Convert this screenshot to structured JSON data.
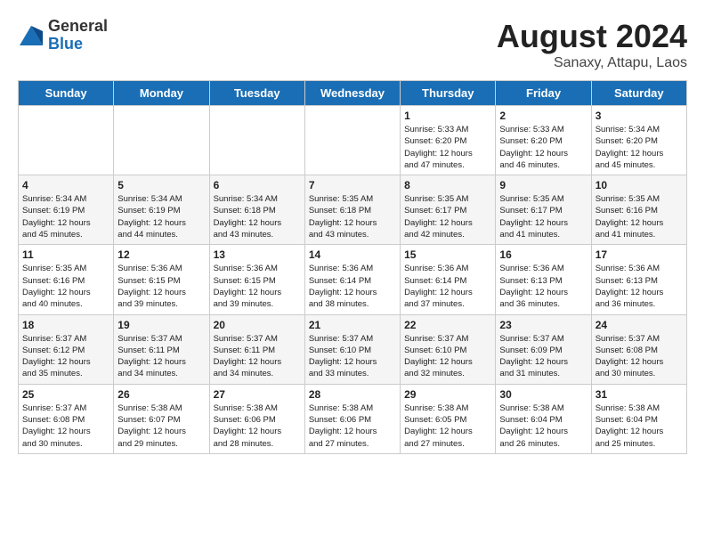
{
  "logo": {
    "general": "General",
    "blue": "Blue"
  },
  "title": "August 2024",
  "location": "Sanaxy, Attapu, Laos",
  "days_of_week": [
    "Sunday",
    "Monday",
    "Tuesday",
    "Wednesday",
    "Thursday",
    "Friday",
    "Saturday"
  ],
  "weeks": [
    [
      {
        "day": "",
        "info": ""
      },
      {
        "day": "",
        "info": ""
      },
      {
        "day": "",
        "info": ""
      },
      {
        "day": "",
        "info": ""
      },
      {
        "day": "1",
        "info": "Sunrise: 5:33 AM\nSunset: 6:20 PM\nDaylight: 12 hours\nand 47 minutes."
      },
      {
        "day": "2",
        "info": "Sunrise: 5:33 AM\nSunset: 6:20 PM\nDaylight: 12 hours\nand 46 minutes."
      },
      {
        "day": "3",
        "info": "Sunrise: 5:34 AM\nSunset: 6:20 PM\nDaylight: 12 hours\nand 45 minutes."
      }
    ],
    [
      {
        "day": "4",
        "info": "Sunrise: 5:34 AM\nSunset: 6:19 PM\nDaylight: 12 hours\nand 45 minutes."
      },
      {
        "day": "5",
        "info": "Sunrise: 5:34 AM\nSunset: 6:19 PM\nDaylight: 12 hours\nand 44 minutes."
      },
      {
        "day": "6",
        "info": "Sunrise: 5:34 AM\nSunset: 6:18 PM\nDaylight: 12 hours\nand 43 minutes."
      },
      {
        "day": "7",
        "info": "Sunrise: 5:35 AM\nSunset: 6:18 PM\nDaylight: 12 hours\nand 43 minutes."
      },
      {
        "day": "8",
        "info": "Sunrise: 5:35 AM\nSunset: 6:17 PM\nDaylight: 12 hours\nand 42 minutes."
      },
      {
        "day": "9",
        "info": "Sunrise: 5:35 AM\nSunset: 6:17 PM\nDaylight: 12 hours\nand 41 minutes."
      },
      {
        "day": "10",
        "info": "Sunrise: 5:35 AM\nSunset: 6:16 PM\nDaylight: 12 hours\nand 41 minutes."
      }
    ],
    [
      {
        "day": "11",
        "info": "Sunrise: 5:35 AM\nSunset: 6:16 PM\nDaylight: 12 hours\nand 40 minutes."
      },
      {
        "day": "12",
        "info": "Sunrise: 5:36 AM\nSunset: 6:15 PM\nDaylight: 12 hours\nand 39 minutes."
      },
      {
        "day": "13",
        "info": "Sunrise: 5:36 AM\nSunset: 6:15 PM\nDaylight: 12 hours\nand 39 minutes."
      },
      {
        "day": "14",
        "info": "Sunrise: 5:36 AM\nSunset: 6:14 PM\nDaylight: 12 hours\nand 38 minutes."
      },
      {
        "day": "15",
        "info": "Sunrise: 5:36 AM\nSunset: 6:14 PM\nDaylight: 12 hours\nand 37 minutes."
      },
      {
        "day": "16",
        "info": "Sunrise: 5:36 AM\nSunset: 6:13 PM\nDaylight: 12 hours\nand 36 minutes."
      },
      {
        "day": "17",
        "info": "Sunrise: 5:36 AM\nSunset: 6:13 PM\nDaylight: 12 hours\nand 36 minutes."
      }
    ],
    [
      {
        "day": "18",
        "info": "Sunrise: 5:37 AM\nSunset: 6:12 PM\nDaylight: 12 hours\nand 35 minutes."
      },
      {
        "day": "19",
        "info": "Sunrise: 5:37 AM\nSunset: 6:11 PM\nDaylight: 12 hours\nand 34 minutes."
      },
      {
        "day": "20",
        "info": "Sunrise: 5:37 AM\nSunset: 6:11 PM\nDaylight: 12 hours\nand 34 minutes."
      },
      {
        "day": "21",
        "info": "Sunrise: 5:37 AM\nSunset: 6:10 PM\nDaylight: 12 hours\nand 33 minutes."
      },
      {
        "day": "22",
        "info": "Sunrise: 5:37 AM\nSunset: 6:10 PM\nDaylight: 12 hours\nand 32 minutes."
      },
      {
        "day": "23",
        "info": "Sunrise: 5:37 AM\nSunset: 6:09 PM\nDaylight: 12 hours\nand 31 minutes."
      },
      {
        "day": "24",
        "info": "Sunrise: 5:37 AM\nSunset: 6:08 PM\nDaylight: 12 hours\nand 30 minutes."
      }
    ],
    [
      {
        "day": "25",
        "info": "Sunrise: 5:37 AM\nSunset: 6:08 PM\nDaylight: 12 hours\nand 30 minutes."
      },
      {
        "day": "26",
        "info": "Sunrise: 5:38 AM\nSunset: 6:07 PM\nDaylight: 12 hours\nand 29 minutes."
      },
      {
        "day": "27",
        "info": "Sunrise: 5:38 AM\nSunset: 6:06 PM\nDaylight: 12 hours\nand 28 minutes."
      },
      {
        "day": "28",
        "info": "Sunrise: 5:38 AM\nSunset: 6:06 PM\nDaylight: 12 hours\nand 27 minutes."
      },
      {
        "day": "29",
        "info": "Sunrise: 5:38 AM\nSunset: 6:05 PM\nDaylight: 12 hours\nand 27 minutes."
      },
      {
        "day": "30",
        "info": "Sunrise: 5:38 AM\nSunset: 6:04 PM\nDaylight: 12 hours\nand 26 minutes."
      },
      {
        "day": "31",
        "info": "Sunrise: 5:38 AM\nSunset: 6:04 PM\nDaylight: 12 hours\nand 25 minutes."
      }
    ]
  ]
}
